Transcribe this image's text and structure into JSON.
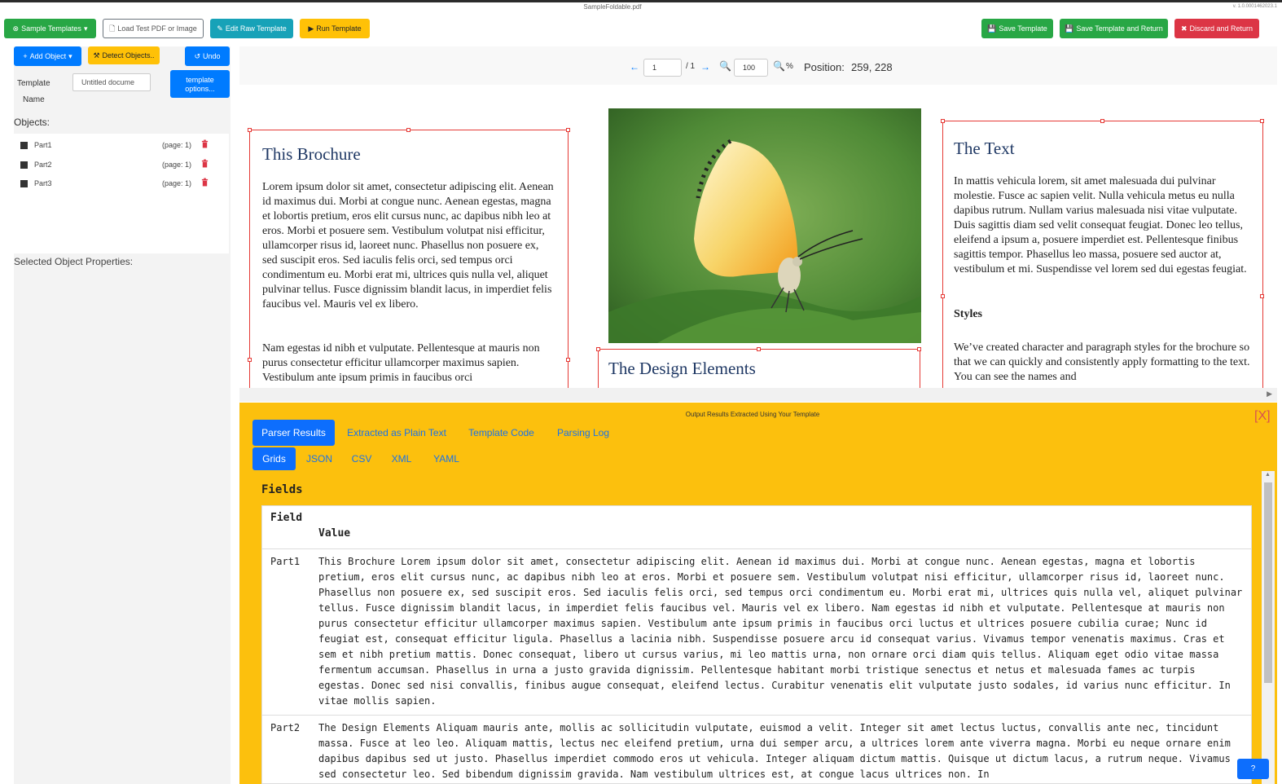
{
  "window": {
    "filename": "SampleFoldable.pdf",
    "version": "v. 1.0.0001462023.1"
  },
  "toolbar": {
    "sample_templates": "Sample Templates",
    "load_test": "Load Test PDF or Image",
    "edit_raw": "Edit Raw Template",
    "run_template": "Run Template",
    "save_template": "Save Template",
    "save_return": "Save Template and Return",
    "discard_return": "Discard and Return"
  },
  "sidebar": {
    "add_object": "Add Object",
    "detect_objects": "Detect Objects..",
    "undo": "Undo",
    "template_label_1": "Template",
    "template_label_2": "Name",
    "template_name_value": "Untitled docume",
    "template_options_1": "template",
    "template_options_2": "options...",
    "objects_title": "Objects:",
    "objects": [
      {
        "name": "Part1",
        "page": "(page: 1)"
      },
      {
        "name": "Part2",
        "page": "(page: 1)"
      },
      {
        "name": "Part3",
        "page": "(page: 1)"
      }
    ],
    "selected_props_title": "Selected Object Properties:"
  },
  "viewer": {
    "page_value": "1",
    "page_total": "/ 1",
    "zoom_value": "100",
    "zoom_unit": "%",
    "position_label": "Position:",
    "position_value": "259, 228"
  },
  "document": {
    "col1_heading": "This Brochure",
    "col1_p1": "Lorem ipsum dolor sit amet, consectetur adipiscing elit. Aenean id maximus dui. Morbi at congue nunc. Aenean egestas, magna et lobortis pretium, eros elit cursus nunc, ac dapibus nibh leo at eros. Morbi et posuere sem. Vestibulum volutpat nisi efficitur, ullamcorper risus id, laoreet nunc. Phasellus non posuere ex, sed suscipit eros. Sed iaculis felis orci, sed tempus orci condimentum eu. Morbi erat mi, ultrices quis nulla vel, aliquet pulvinar tellus. Fusce dignissim blandit lacus, in imperdiet felis faucibus vel. Mauris vel ex libero.",
    "col1_p2": "Nam egestas id nibh et vulputate. Pellentesque at mauris non purus consectetur efficitur ullamcorper maximus sapien. Vestibulum ante ipsum primis in faucibus orci",
    "col2_heading": "The Design Elements",
    "col3_heading": "The Text",
    "col3_p1": "In mattis vehicula lorem, sit amet malesuada dui pulvinar molestie. Fusce ac sapien velit. Nulla vehicula metus eu nulla dapibus rutrum. Nullam varius malesuada nisi vitae vulputate. Duis sagittis diam sed velit consequat feugiat. Donec leo tellus, eleifend a ipsum a, posuere imperdiet est. Pellentesque finibus sagittis tempor. Phasellus leo massa, posuere sed auctor at, vestibulum et mi. Suspendisse vel lorem sed dui egestas feugiat.",
    "col3_subheading": "Styles",
    "col3_p2": "We’ve created character and paragraph styles for the brochure so that we can quickly and consistently apply formatting to the text. You can see the names and"
  },
  "results": {
    "title": "Output Results Extracted Using Your Template",
    "close": "[X]",
    "tabs": [
      "Parser Results",
      "Extracted as Plain Text",
      "Template Code",
      "Parsing Log"
    ],
    "subtabs": [
      "Grids",
      "JSON",
      "CSV",
      "XML",
      "YAML"
    ],
    "fields_title": "Fields",
    "col_field": "Field",
    "col_value": "Value",
    "rows": [
      {
        "field": "Part1",
        "value": "This Brochure Lorem ipsum dolor sit amet, consectetur adipiscing elit. Aenean id maximus dui. Morbi at congue nunc. Aenean egestas, magna et lobortis pretium, eros elit cursus nunc, ac dapibus nibh leo at eros. Morbi et posuere sem. Vestibulum volutpat nisi efficitur, ullamcorper risus id, laoreet nunc. Phasellus non posuere ex, sed suscipit eros. Sed iaculis felis orci, sed tempus orci condimentum eu. Morbi erat mi, ultrices quis nulla vel, aliquet pulvinar tellus. Fusce dignissim blandit lacus, in imperdiet felis faucibus vel. Mauris vel ex libero. Nam egestas id nibh et vulputate. Pellentesque at mauris non purus consectetur efficitur ullamcorper maximus sapien. Vestibulum ante ipsum primis in faucibus orci luctus et ultrices posuere cubilia curae; Nunc id feugiat est, consequat efficitur ligula. Phasellus a lacinia nibh. Suspendisse posuere arcu id consequat varius. Vivamus tempor venenatis maximus. Cras et sem et nibh pretium mattis. Donec consequat, libero ut cursus varius, mi leo mattis urna, non ornare orci diam quis tellus. Aliquam eget odio vitae massa fermentum accumsan. Phasellus in urna a justo gravida dignissim. Pellentesque habitant morbi tristique senectus et netus et malesuada fames ac turpis egestas. Donec sed nisi convallis, finibus augue consequat, eleifend lectus. Curabitur venenatis elit vulputate justo sodales, id varius nunc efficitur. In vitae mollis sapien."
      },
      {
        "field": "Part2",
        "value": "The Design Elements Aliquam mauris ante, mollis ac sollicitudin vulputate, euismod a velit. Integer sit amet lectus luctus, convallis ante nec, tincidunt massa. Fusce at leo leo. Aliquam mattis, lectus nec eleifend pretium, urna dui semper arcu, a ultrices lorem ante viverra magna. Morbi eu neque ornare enim dapibus dapibus sed ut justo. Phasellus imperdiet commodo eros ut vehicula. Integer aliquam dictum mattis. Quisque ut dictum lacus, a rutrum neque. Vivamus sed consectetur leo. Sed bibendum dignissim gravida. Nam vestibulum ultrices est, at congue lacus ultrices non. In"
      }
    ]
  },
  "help_label": "?",
  "icons": {
    "sample": "circle-x-icon",
    "load": "file-icon",
    "edit": "edit-icon",
    "run": "play-icon",
    "save": "save-icon",
    "discard": "x-icon",
    "add": "plus-icon",
    "detect": "wand-icon",
    "undo": "undo-icon",
    "prev": "arrow-left-icon",
    "next": "arrow-right-icon",
    "zoom_out": "zoom-out-icon",
    "zoom_in": "zoom-in-icon",
    "trash": "trash-icon"
  },
  "colors": {
    "accent_yellow": "#fcc00d",
    "accent_blue": "#0d6efd",
    "selection_red": "#e53935"
  }
}
